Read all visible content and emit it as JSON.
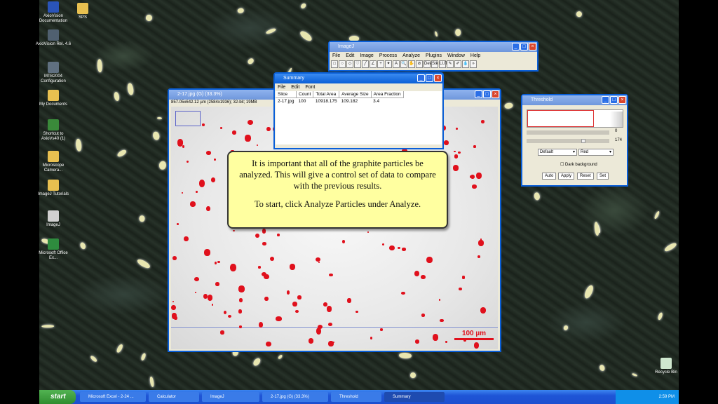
{
  "desktop": {
    "icons": [
      {
        "label": "AxioVision Documentation",
        "color": "#2a54b8"
      },
      {
        "label": "AxioVision Rel. 4.6",
        "color": "#506070"
      },
      {
        "label": "MTB2004 Configuration",
        "color": "#607080"
      },
      {
        "label": "My Documents",
        "color": "#e8c050"
      },
      {
        "label": "Shortcut to AxioVs40 (1)",
        "color": "#3a8a3a"
      },
      {
        "label": "Microscope Camera...",
        "color": "#e8c050"
      },
      {
        "label": "ImageJ Tutorials",
        "color": "#e8c050"
      },
      {
        "label": "ImageJ",
        "color": "#d0d0d0"
      },
      {
        "label": "Microsoft Office Ex...",
        "color": "#2e8b3e"
      }
    ],
    "top_icon2_label": "SPS",
    "recycle_label": "Recycle Bin"
  },
  "imagej": {
    "title": "ImageJ",
    "menu": [
      "File",
      "Edit",
      "Image",
      "Process",
      "Analyze",
      "Plugins",
      "Window",
      "Help"
    ],
    "tools": [
      "rect",
      "oval",
      "poly",
      "free",
      "line",
      "angle",
      "point",
      "wand",
      "text",
      "zoom",
      "hand",
      "drop",
      "dev",
      "stk",
      "lut",
      "pen",
      "brush",
      "flood",
      "more"
    ],
    "tool_glyphs": [
      "□",
      "○",
      "◇",
      "♡",
      "╱",
      "∠",
      "+",
      "✦",
      "A",
      "🔍",
      "✋",
      "⊘",
      "Dev",
      "Stk",
      "LUT",
      "✎",
      "✐",
      "💧",
      "»"
    ]
  },
  "summary": {
    "title": "Summary",
    "menu": [
      "File",
      "Edit",
      "Font"
    ],
    "columns": [
      "Slice",
      "Count",
      "Total Area",
      "Average Size",
      "Area Fraction"
    ],
    "rows": [
      [
        "2-17.jpg",
        "100",
        "10918.175",
        "109.182",
        "3.4"
      ]
    ]
  },
  "image_window": {
    "title": "2-17.jpg (G) (33.3%)",
    "info": "857.05x642.12 µm (2584x1936); 32-bit; 19MB",
    "scalebar": "100 µm"
  },
  "threshold": {
    "title": "Threshold",
    "slider1_value": "0",
    "slider2_value": "174",
    "method": "Default",
    "color": "Red",
    "dark_background_label": "Dark background",
    "buttons": [
      "Auto",
      "Apply",
      "Reset",
      "Set"
    ]
  },
  "callout": {
    "line1": "It is important that all of the graphite particles be analyzed. This will give a control set of data to compare with the previous results.",
    "line2": "To start, click Analyze Particles under Analyze."
  },
  "taskbar": {
    "start_label": "start",
    "tasks": [
      "Microsoft Excel - 2-24 ...",
      "Calculator",
      "ImageJ",
      "2-17.jpg (G) (33.3%)",
      "Threshold",
      "Summary"
    ],
    "clock": "2:59 PM"
  }
}
